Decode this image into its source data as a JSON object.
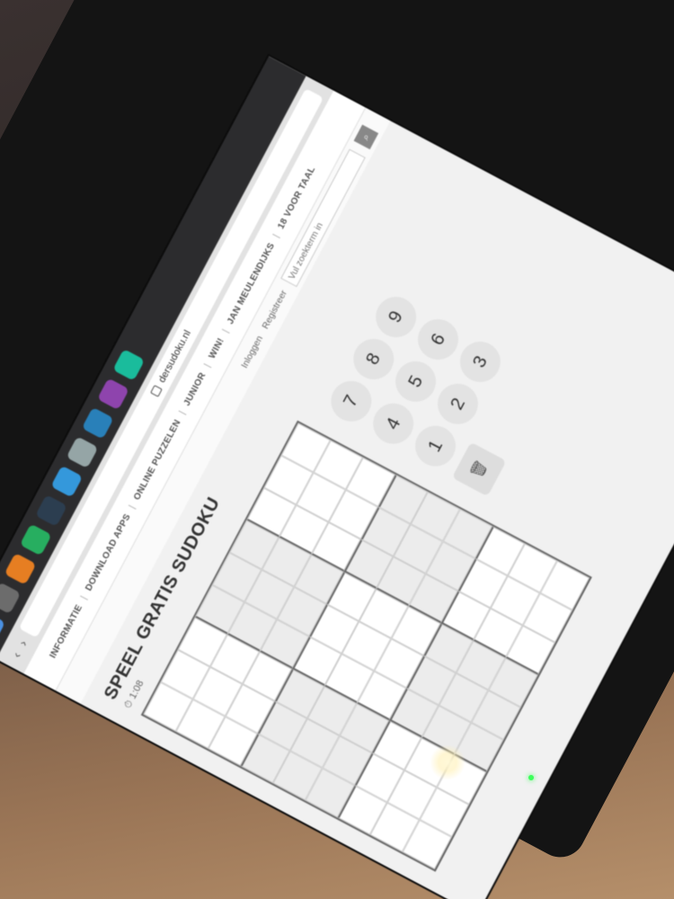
{
  "browser": {
    "url": "dersudoku.nl",
    "back_label": "‹",
    "forward_label": "›"
  },
  "site": {
    "brand": "",
    "menu": [
      "INFORMATIE",
      "DOWNLOAD APPS",
      "ONLINE PUZZELEN",
      "JUNIOR",
      "WIN!",
      "JAN MEULENDIJKS",
      "18 VOOR TAAL"
    ],
    "login_label": "Inloggen",
    "register_label": "Registreer",
    "search_placeholder": "Vul zoekterm in",
    "search_icon_label": "⌕"
  },
  "page": {
    "title": "SPEEL GRATIS SUDOKU",
    "timer": "⏱ 1:08",
    "intro": ""
  },
  "sudoku": {
    "rows": [
      [
        "",
        "",
        "",
        "",
        "",
        "",
        "",
        "",
        ""
      ],
      [
        "",
        "",
        "",
        "",
        "",
        "",
        "",
        "",
        ""
      ],
      [
        "",
        "",
        "",
        "",
        "",
        "",
        "",
        "",
        ""
      ],
      [
        "",
        "",
        "",
        "",
        "",
        "",
        "",
        "",
        ""
      ],
      [
        "",
        "",
        "",
        "",
        "",
        "",
        "",
        "",
        ""
      ],
      [
        "",
        "",
        "",
        "",
        "",
        "",
        "",
        "",
        ""
      ],
      [
        "",
        "",
        "",
        "",
        "",
        "",
        "",
        "",
        ""
      ],
      [
        "",
        "",
        "",
        "",
        "",
        "",
        "",
        "",
        ""
      ],
      [
        "",
        "",
        "",
        "",
        "",
        "",
        "",
        "",
        ""
      ]
    ]
  },
  "keypad": {
    "keys": [
      "7",
      "8",
      "9",
      "4",
      "5",
      "6",
      "1",
      "2",
      "3"
    ],
    "trash_icon": "🗑"
  },
  "colors": {
    "accent": "#c0392b",
    "led": "#3cff5a"
  }
}
